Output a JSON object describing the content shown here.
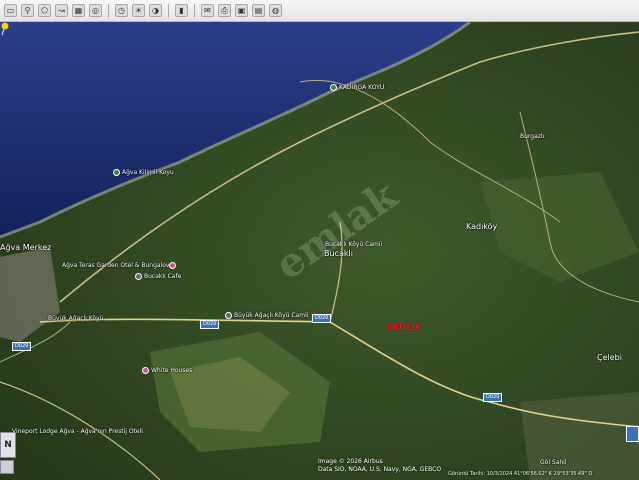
{
  "toolbar": {
    "icons": [
      "rectangle-select-icon",
      "placemark-icon",
      "polygon-icon",
      "path-icon",
      "overlay-icon",
      "tour-icon",
      "history-icon",
      "sun-icon",
      "planets-icon",
      "ruler-icon",
      "email-icon",
      "print-icon",
      "save-image-icon",
      "maps-icon",
      "earth-icon"
    ]
  },
  "map": {
    "places": {
      "kadirga": "KADIRGA KOYU",
      "kilimli": "Ağva Kilimli Koyu",
      "merkez": "Ağva Merkez",
      "teras": "Ağva Teras Garden Otel & Bungalov",
      "bucakli_cafe": "Bucaklı Cafe",
      "bucakli_cami": "Bucaklı Köyü Camii",
      "bucakli": "Bucaklı",
      "burgazli": "Burgazlı",
      "kadikoy": "Kadıköy",
      "buyuk_cami": "Büyük Ağaçlı Köyü Camii",
      "buyuk_shop": "Büyük Ağaçlı Köyü",
      "white_houses": "White Houses",
      "celebi": "Çelebi",
      "vineport": "Vineport Lodge Ağva - Ağva'nın Prestij Oteli",
      "gol": "Göl Sahil"
    },
    "roads": {
      "d020_a": "D020",
      "d020_b": "D020",
      "d020_c": "D020",
      "d020_d": "D020"
    },
    "sale_marker": "SATILIK",
    "watermark": "emlak"
  },
  "credits": {
    "line1": "Image © 2026 Airbus",
    "line2": "Data SIO, NOAA, U.S. Navy, NGA, GEBCO"
  },
  "status": {
    "text": "Görüntü Tarihi: 10/3/2024   41°06'56.62\" K 29°53'35.49\" D"
  },
  "nav": {
    "label": "N"
  },
  "colors": {
    "sea": "#1c2d6e",
    "forest": "#2f4a1f",
    "road": "#d9c98c",
    "sale_red": "#e0181f"
  }
}
